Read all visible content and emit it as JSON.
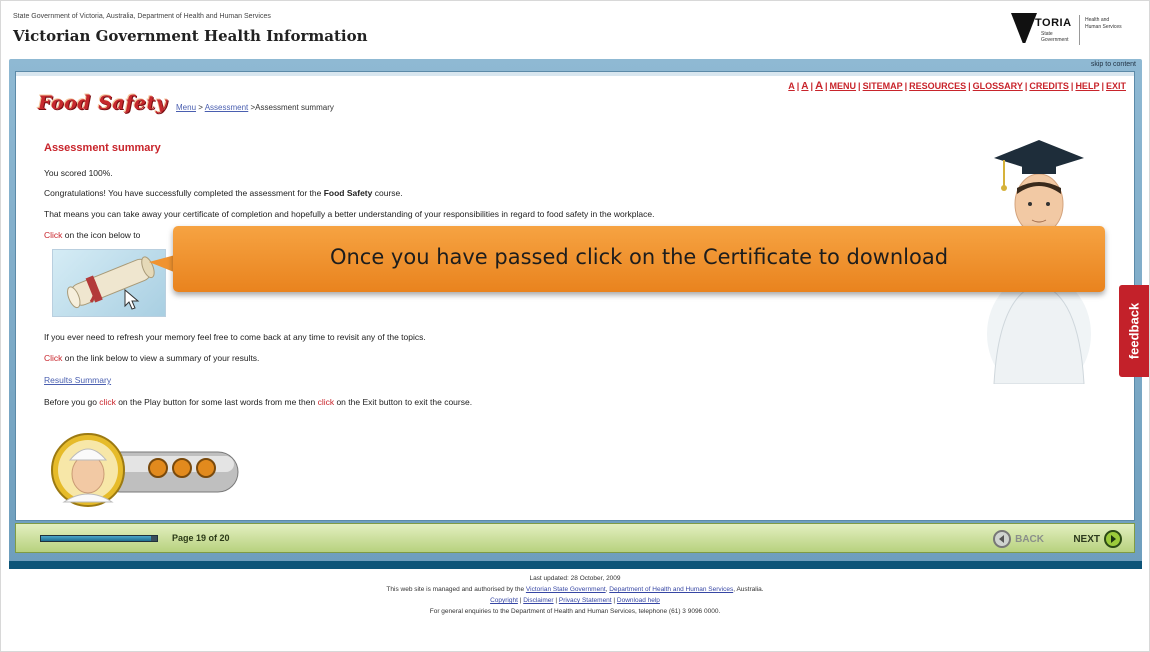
{
  "header": {
    "gov_line": "State Government of Victoria, Australia, Department of Health and Human Services",
    "site_title": "Victorian Government Health Information",
    "logo": {
      "word": "TORIA",
      "sub": "State Government",
      "dept": "Health and Human Services"
    }
  },
  "skip_link": "skip to content",
  "top_links": [
    "A",
    "A",
    "A",
    "MENU",
    "SITEMAP",
    "RESOURCES",
    "GLOSSARY",
    "CREDITS",
    "HELP",
    "EXIT"
  ],
  "course_logo": "Food Safety",
  "breadcrumb": {
    "menu": "Menu",
    "sep1": " > ",
    "assessment": "Assessment",
    "current": " >Assessment summary"
  },
  "main": {
    "title": "Assessment summary",
    "score_line": "You scored 100%.",
    "congrats_pre": "Congratulations! You have successfully completed the assessment for the ",
    "congrats_course": "Food Safety",
    "congrats_post": " course.",
    "means_line": "That means you can take away your certificate of completion and hopefully a better understanding of your responsibilities in regard to food safety in the workplace.",
    "click_word": "Click",
    "icon_line": " on the icon below to",
    "refresh_line": "If you ever need to refresh your memory feel free to come back at any time to revisit any of the topics.",
    "link_line": " on the link below to view a summary of your results.",
    "results_link": "Results Summary",
    "before_pre": "Before you go ",
    "click_lower": "click",
    "before_mid": " on the Play button for some last words from me then ",
    "before_post": " on the Exit button to exit the course."
  },
  "callout": "Once you have passed click on the Certificate to download",
  "navbar": {
    "progress": 0.95,
    "page_indicator": "Page 19 of 20",
    "back": "BACK",
    "next": "NEXT"
  },
  "feedback": "feedback",
  "footer": {
    "last_updated": "Last updated: 28 October, 2009",
    "managed_pre": "This web site is managed and authorised by the ",
    "managed_link1": "Victorian State Government",
    "managed_sep": ", ",
    "managed_link2": "Department of Health and Human Services",
    "managed_post": ", Australia.",
    "links": [
      "Copyright",
      "Disclaimer",
      "Privacy Statement",
      "Download help"
    ],
    "enquiries": "For general enquiries to the Department of Health and Human Services, telephone (61) 3 9096 0000."
  },
  "colors": {
    "brand_red": "#c8242b",
    "link_blue": "#4a5fb0",
    "callout_orange": "#f09330",
    "frame_blue": "#6e9ebd",
    "nav_green": "#b7d17e"
  }
}
